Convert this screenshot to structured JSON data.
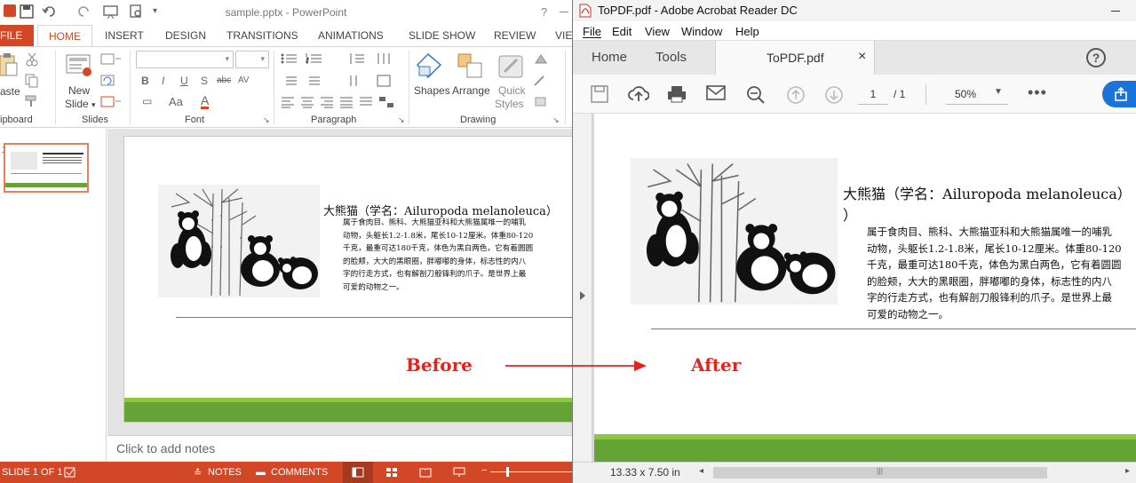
{
  "ppt": {
    "window_title": "sample.pptx - PowerPoint",
    "help": "?",
    "tabs": {
      "file": "FILE",
      "home": "HOME",
      "insert": "INSERT",
      "design": "DESIGN",
      "transitions": "TRANSITIONS",
      "animations": "ANIMATIONS",
      "slideshow": "SLIDE SHOW",
      "review": "REVIEW",
      "view": "VIE"
    },
    "ribbon": {
      "paste": "aste",
      "new_slide_1": "New",
      "new_slide_2": "Slide",
      "layout_arrow": "▾",
      "shapes": "Shapes",
      "arrange": "Arrange",
      "quick_1": "Quick",
      "quick_2": "Styles",
      "group_clipboard": "ipboard",
      "group_slides": "Slides",
      "group_font": "Font",
      "group_paragraph": "Paragraph",
      "group_drawing": "Drawing",
      "bold": "B",
      "italic": "I",
      "underline": "U",
      "shadow": "S",
      "strike": "abc",
      "spacing": "AV",
      "case": "Aa",
      "fontcolor": "A"
    },
    "thumb_number": "1",
    "notes_placeholder": "Click to add notes",
    "status": {
      "slide": "SLIDE 1 OF 1",
      "notes": "NOTES",
      "comments": "COMMENTS"
    }
  },
  "slide": {
    "title": "大熊猫（学名：Ailuropoda melanoleuca）",
    "body": [
      "属于食肉目、熊科、大熊猫亚科和大熊猫属唯一的哺乳",
      "动物，头躯长1.2-1.8米，尾长10-12厘米。体重80-120",
      "千克，最重可达180千克，体色为黑白两色，它有着圆圆",
      "的脸颊，大大的黑眼圈，胖嘟嘟的身体，标志性的内八",
      "字的行走方式，也有解剖刀般锋利的爪子。是世界上最",
      "可爱的动物之一。"
    ]
  },
  "annotation": {
    "before": "Before",
    "after": "After",
    "color": "#e5231b"
  },
  "pdf": {
    "window_title": "ToPDF.pdf - Adobe Acrobat Reader DC",
    "menu": [
      "File",
      "Edit",
      "View",
      "Window",
      "Help"
    ],
    "tab_home": "Home",
    "tab_tools": "Tools",
    "doc_tab": "ToPDF.pdf",
    "close": "×",
    "help": "?",
    "page_current": "1",
    "page_total": "/ 1",
    "zoom": "50%",
    "dimensions": "13.33 x 7.50 in",
    "title_close": "×",
    "title_line2": "）"
  },
  "colors": {
    "ppt_accent": "#d24726",
    "green_bar": "#66a336",
    "pdf_blue": "#1a73d9"
  }
}
